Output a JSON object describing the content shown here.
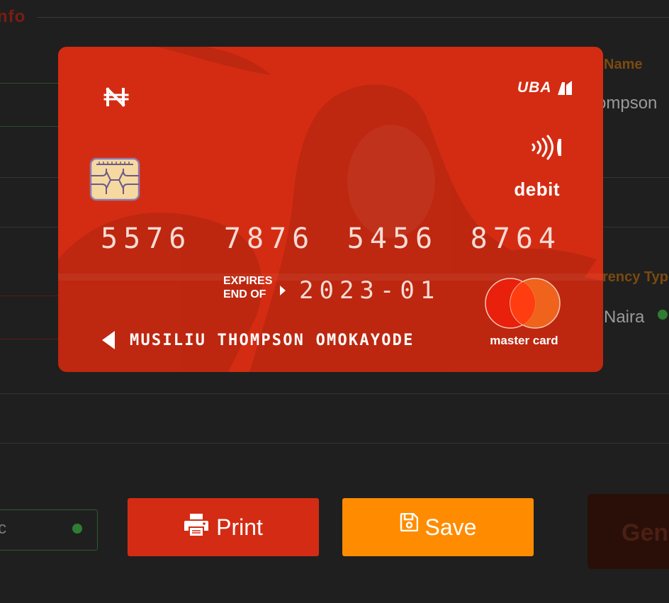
{
  "background_form": {
    "legend": "nfo",
    "right_label_1": "Name",
    "right_value_1": "ompson",
    "right_label_2": "rency Typ",
    "right_value_2": "Naira",
    "select_value": "c",
    "generate_label": "Gen"
  },
  "card": {
    "bank": "UBA",
    "currency_icon": "naira-icon",
    "type": "debit",
    "number_groups": [
      "5576",
      "7876",
      "5456",
      "8764"
    ],
    "expires_label": "EXPIRES END OF",
    "expiry": "2023-01",
    "holder": "MUSILIU THOMPSON OMOKAYODE",
    "network": "master card",
    "colors": {
      "card": "#d42c12",
      "mastercard_left": "#e8200c",
      "mastercard_right": "#f46a1e"
    }
  },
  "actions": {
    "print_label": "Print",
    "print_icon": "printer-icon",
    "save_label": "Save",
    "save_icon": "floppy-disk-icon",
    "print_color": "#d42c14",
    "save_color": "#ff8c00"
  }
}
